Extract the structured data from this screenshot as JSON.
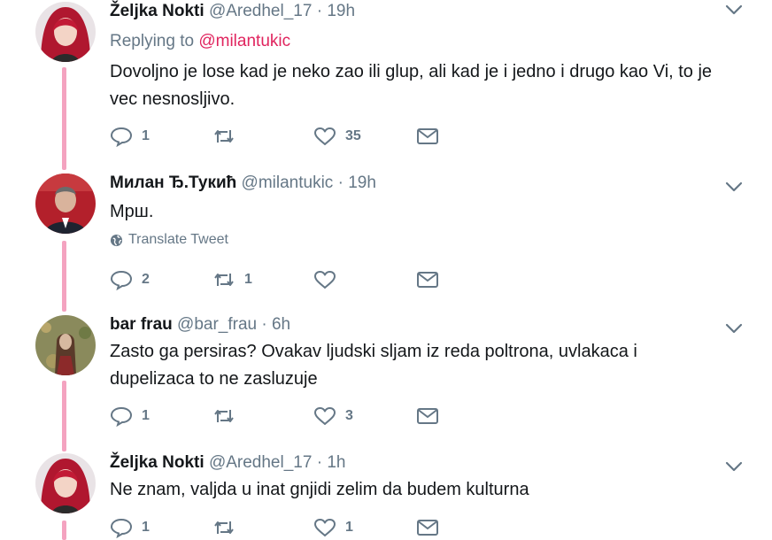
{
  "tweets": [
    {
      "name": "Željka Nokti",
      "handle": "@Aredhel_17",
      "separator": "·",
      "time": "19h",
      "replying_prefix": "Replying to",
      "replying_to": "@milantukic",
      "text": "Dovoljno je lose kad je neko zao ili glup, ali kad je i jedno i drugo kao Vi, to je vec nesnosljivo.",
      "replies": "1",
      "retweets": "",
      "likes": "35"
    },
    {
      "name": "Милан Ђ.Тукић",
      "handle": "@milantukic",
      "separator": "·",
      "time": "19h",
      "text": "Мрш.",
      "translate_label": "Translate Tweet",
      "replies": "2",
      "retweets": "1",
      "likes": ""
    },
    {
      "name": "bar frau",
      "handle": "@bar_frau",
      "separator": "·",
      "time": "6h",
      "text": "Zasto ga persiras? Ovakav ljudski sljam iz reda poltrona, uvlakaca i dupelizaca to ne zasluzuje",
      "replies": "1",
      "retweets": "",
      "likes": "3"
    },
    {
      "name": "Željka Nokti",
      "handle": "@Aredhel_17",
      "separator": "·",
      "time": "1h",
      "text": "Ne znam, valjda u inat gnjidi zelim da budem kulturna",
      "replies": "1",
      "retweets": "",
      "likes": "1"
    }
  ],
  "colors": {
    "thread_line": "#f4a3c0",
    "mention": "#e0245e",
    "secondary_text": "#657786",
    "primary_text": "#14171a"
  },
  "icons": [
    "reply-icon",
    "retweet-icon",
    "like-icon",
    "direct-message-icon",
    "chevron-down-icon",
    "globe-icon"
  ]
}
